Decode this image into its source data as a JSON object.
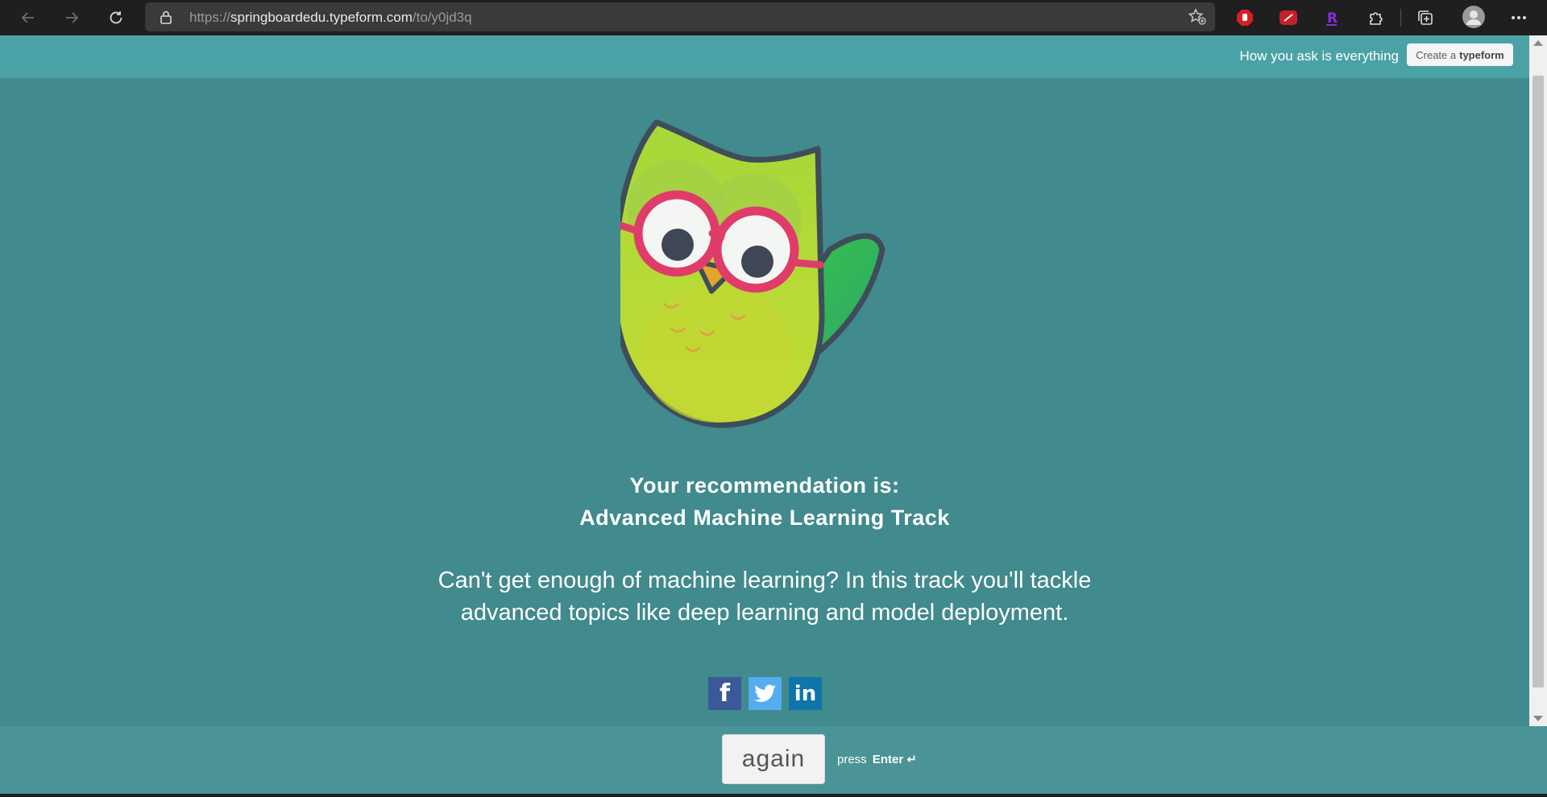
{
  "browser": {
    "url_prefix": "https://",
    "url_host": "springboardedu.typeform.com",
    "url_path": "/to/y0jd3q"
  },
  "header": {
    "tagline": "How you ask is everything",
    "create_prefix": "Create a",
    "create_brand": "typeform"
  },
  "result": {
    "title_line1": "Your recommendation is:",
    "title_line2": "Advanced Machine Learning Track",
    "description": "Can't get enough of machine learning? In this track you'll tackle advanced topics like deep learning and model deployment."
  },
  "social": {
    "facebook_glyph": "f",
    "linkedin_glyph": "in"
  },
  "footer": {
    "again_label": "again",
    "press_label": "press",
    "enter_label": "Enter ↵"
  },
  "colors": {
    "background": "#418a8d",
    "header": "#4aa2a6",
    "footer": "#4a9497",
    "facebook": "#3b5998",
    "twitter": "#55acee",
    "linkedin": "#0e76a8"
  }
}
